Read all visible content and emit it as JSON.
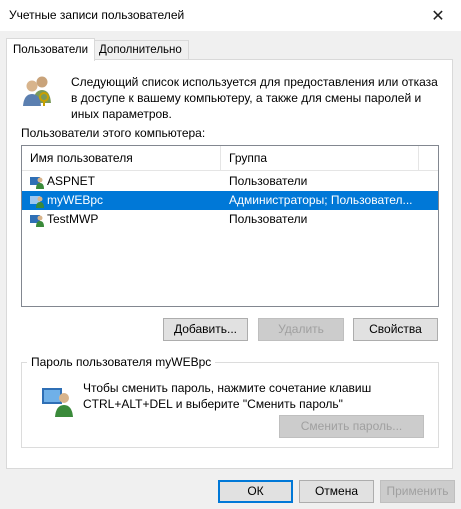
{
  "window": {
    "title": "Учетные записи пользователей",
    "close_glyph": "✕"
  },
  "tabs": [
    {
      "label": "Пользователи",
      "active": true
    },
    {
      "label": "Дополнительно",
      "active": false
    }
  ],
  "description": "Следующий список используется для предоставления или отказа в доступе к вашему компьютеру, а также для смены паролей и иных параметров.",
  "list_label": "Пользователи этого компьютера:",
  "columns": [
    "Имя пользователя",
    "Группа"
  ],
  "users": [
    {
      "name": "ASPNET",
      "group": "Пользователи",
      "selected": false
    },
    {
      "name": "myWEBpc",
      "group": "Администраторы; Пользовател...",
      "selected": true
    },
    {
      "name": "TestMWP",
      "group": "Пользователи",
      "selected": false
    }
  ],
  "list_buttons": {
    "add": "Добавить...",
    "remove": "Удалить",
    "properties": "Свойства"
  },
  "password_group": {
    "title": "Пароль пользователя myWEBpc",
    "text": "Чтобы сменить пароль, нажмите сочетание клавиш CTRL+ALT+DEL и выберите \"Сменить пароль\"",
    "button": "Сменить пароль..."
  },
  "dialog_buttons": {
    "ok": "ОК",
    "cancel": "Отмена",
    "apply": "Применить"
  },
  "colors": {
    "selection": "#0078d7",
    "background": "#f0f0f0"
  }
}
